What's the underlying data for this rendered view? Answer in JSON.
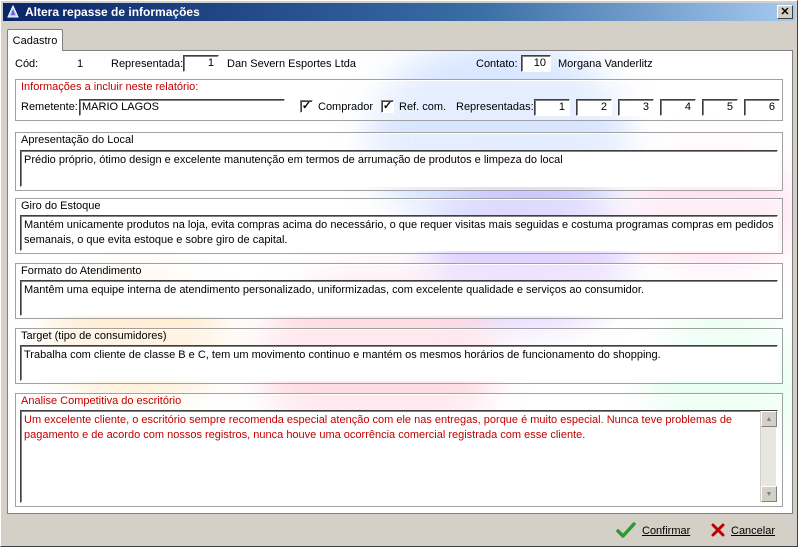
{
  "window": {
    "title": "Altera repasse de informações",
    "close_glyph": "✕"
  },
  "tabs": [
    {
      "label": "Cadastro"
    }
  ],
  "header": {
    "cod_label": "Cód:",
    "cod_value": "1",
    "representada_label": "Representada:",
    "representada_id": "1",
    "representada_name": "Dan Severn Esportes Ltda",
    "contato_label": "Contato:",
    "contato_id": "10",
    "contato_name": "Morgana Vanderlitz"
  },
  "report_info": {
    "title": "Informações a incluir neste relatório:",
    "remetente_label": "Remetente:",
    "remetente_value": "MARIO LAGOS",
    "comprador_label": "Comprador",
    "comprador_checked": true,
    "refcom_label": "Ref. com.",
    "refcom_checked": true,
    "representadas_label": "Representadas:",
    "representadas": [
      "1",
      "2",
      "3",
      "4",
      "5",
      "6"
    ]
  },
  "sections": {
    "apresentacao": {
      "title": "Apresentação do Local",
      "text": "Prédio próprio, ótimo design e excelente manutenção em termos de arrumação de produtos e limpeza do local"
    },
    "giro": {
      "title": "Giro do Estoque",
      "text": "Mantém unicamente produtos na loja, evita compras acima do necessário, o que requer visitas mais seguidas e costuma programas compras em pedidos semanais, o que evita estoque e sobre giro de capital."
    },
    "formato": {
      "title": "Formato do Atendimento",
      "text": "Mantêm uma equipe interna de atendimento personalizado, uniformizadas, com excelente qualidade e serviços ao consumidor."
    },
    "target": {
      "title": "Target (tipo de consumidores)",
      "text": "Trabalha com cliente de classe B e C, tem um movimento continuo e mantém os mesmos horários de funcionamento do shopping."
    },
    "analise": {
      "title": "Analise Competitiva do escritório",
      "text": "Um excelente cliente, o escritório sempre recomenda especial atenção com ele nas entregas, porque é muito especial. Nunca teve problemas de pagamento e de acordo com nossos registros, nunca houve uma ocorrência comercial registrada com esse cliente."
    }
  },
  "buttons": {
    "confirm_label": "Confirmar",
    "cancel_label": "Cancelar"
  },
  "icons": {
    "app": "app-icon",
    "confirm": "checkmark-icon",
    "cancel": "x-icon",
    "check_glyph": "✓"
  },
  "colors": {
    "title_bar": "#0a246a",
    "section_red": "#c00000",
    "confirm_green": "#2e9a2e",
    "cancel_red": "#c00000"
  }
}
